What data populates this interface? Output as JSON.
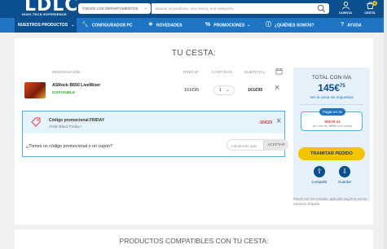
{
  "header": {
    "logo_text": "LDLC",
    "logo_tagline": "HIGH-TECH EXPERIENCE",
    "departments_label": "TODOS LOS DEPARTAMENTOS",
    "search_placeholder": "Buscar un producto, una marca, una categoría...",
    "account_label": "CUENTA",
    "cart_label": "CESTA",
    "cart_count": "1"
  },
  "nav": {
    "items": [
      {
        "label": "NUESTROS PRODUCTOS",
        "icon": "chevron-down-icon"
      },
      {
        "label": "CONFIGURADOR PC",
        "icon": "wrench-icon"
      },
      {
        "label": "NOVEDADES",
        "icon": "sparkle-icon"
      },
      {
        "label": "PROMOCIONES",
        "icon": "percent-icon"
      },
      {
        "label": "¿QUIÉNES SOMOS?",
        "icon": "info-icon"
      },
      {
        "label": "AYUDA",
        "icon": "question-icon"
      }
    ]
  },
  "cart": {
    "title": "TU CESTA:",
    "columns": {
      "designation": "DESIGNACIÓN",
      "price": "PRECIO",
      "quantity": "CANTIDAD",
      "subtotal": "SUBTOTAL"
    },
    "item": {
      "name": "ASRock B650 LiveMixer",
      "stock": "DISPONIBLE",
      "price": "161€95",
      "quantity": "1",
      "subtotal": "161€95"
    },
    "promo": {
      "title": "Código promocional FRIDAY",
      "subtitle": "¡Feliz Black Friday !",
      "discount": "-16€20"
    },
    "code": {
      "question": "¿Tienes un código promocional o un cupón?",
      "placeholder": "Introducirlo aquí",
      "button": "ACEPTAR"
    }
  },
  "summary": {
    "total_label": "TOTAL CON IVA",
    "total_int": "145€",
    "total_dec": "75",
    "no_tax_link": "Ver la cesta sin impuestos",
    "finance_pill": "Pagar en 3x",
    "finance_amount": "50€76 x3",
    "finance_note": "(en vez de 48€58 con coste)",
    "checkout": "TRAMITAR PEDIDO",
    "save_label": "Compartir",
    "keep_label": "Guardar",
    "note": "Precio con IVA incluido, aplicado según la norma nacional. España"
  },
  "compat_title": "PRODUCTOS COMPATIBLES CON TU CESTA:",
  "colors": {
    "brand": "#0b4f8f",
    "nav": "#1d74c2",
    "accent": "#f5c400",
    "discount": "#e23b3b"
  }
}
